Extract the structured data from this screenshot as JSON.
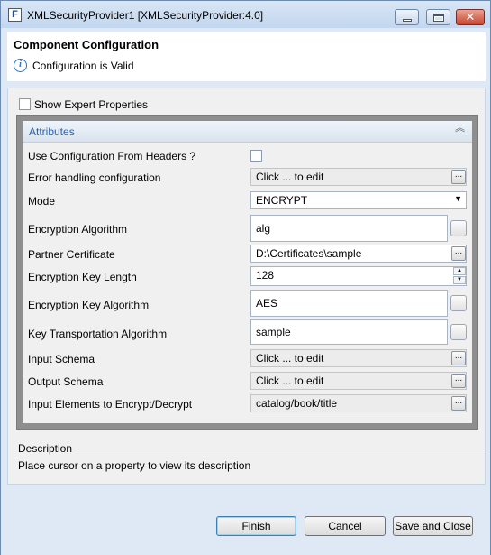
{
  "window": {
    "title": "XMLSecurityProvider1 [XMLSecurityProvider:4.0]",
    "app_icon_letter": "F"
  },
  "header": {
    "title": "Component Configuration",
    "status": "Configuration is Valid"
  },
  "expert": {
    "label": "Show Expert Properties",
    "checked": false
  },
  "attributes": {
    "title": "Attributes",
    "rows": {
      "use_config_headers": {
        "label": "Use Configuration From Headers ?",
        "checked": false
      },
      "error_handling": {
        "label": "Error handling configuration",
        "value": "Click ... to edit"
      },
      "mode": {
        "label": "Mode",
        "value": "ENCRYPT"
      },
      "encryption_algorithm": {
        "label": "Encryption Algorithm",
        "value": "alg"
      },
      "partner_certificate": {
        "label": "Partner Certificate",
        "value": "D:\\Certificates\\sample"
      },
      "encryption_key_length": {
        "label": "Encryption Key Length",
        "value": "128"
      },
      "encryption_key_algorithm": {
        "label": "Encryption Key Algorithm",
        "value": "AES"
      },
      "key_transport_algorithm": {
        "label": "Key Transportation Algorithm",
        "value": "sample"
      },
      "input_schema": {
        "label": "Input Schema",
        "value": "Click ... to edit"
      },
      "output_schema": {
        "label": "Output Schema",
        "value": "Click ... to edit"
      },
      "input_elements": {
        "label": "Input Elements to Encrypt/Decrypt",
        "value": "catalog/book/title"
      }
    },
    "dots": "..."
  },
  "description": {
    "title": "Description",
    "text": "Place cursor on a property to view its description"
  },
  "buttons": {
    "finish": "Finish",
    "cancel": "Cancel",
    "save_close": "Save and Close"
  },
  "colors": {
    "accent": "#2a62b5",
    "window_frame": "#dfe9f5",
    "close_button": "#c8452f"
  },
  "icons": {
    "app": "app-icon",
    "info": "info-icon",
    "minimize": "minimize-icon",
    "maximize": "maximize-icon",
    "close": "close-icon",
    "collapse": "double-chevron-up-icon",
    "dropdown": "dropdown-arrow-icon"
  }
}
